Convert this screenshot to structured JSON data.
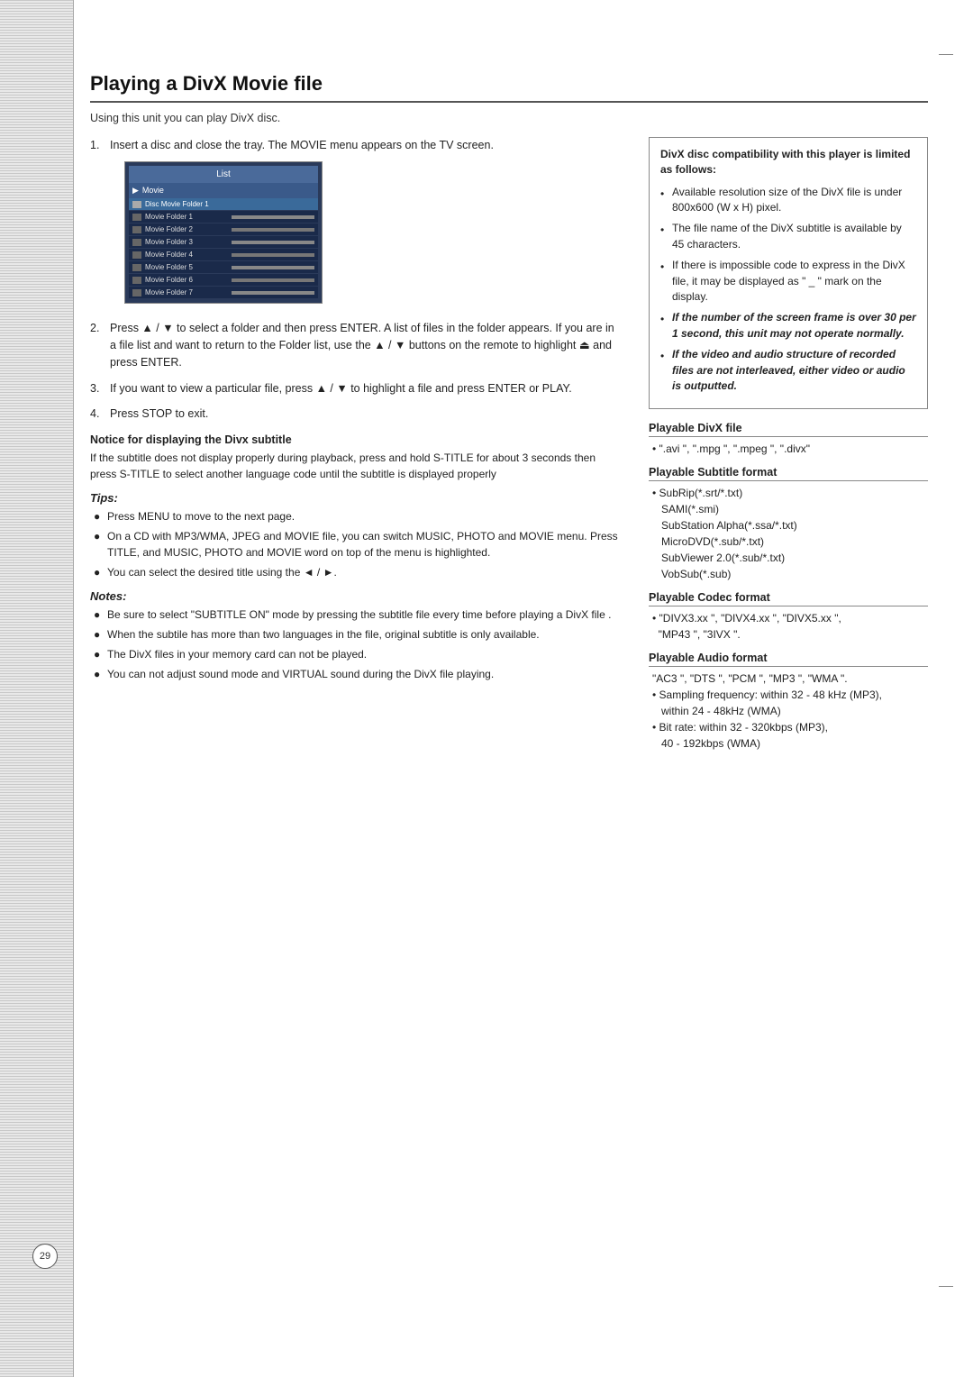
{
  "page": {
    "number": "29",
    "title": "Playing a DivX Movie file",
    "intro": "Using this unit you can play DivX disc."
  },
  "steps": [
    {
      "number": "1.",
      "text": "Insert a disc and close the tray. The MOVIE menu appears on the TV screen."
    },
    {
      "number": "2.",
      "text": "Press ▲ / ▼ to select a folder and then press ENTER. A list of files in the folder appears. If you are in a file list and want to return to the Folder list, use the ▲ / ▼ buttons on the remote to highlight ⏏  and press ENTER."
    },
    {
      "number": "3.",
      "text": "If you want to view a particular file, press ▲ / ▼ to highlight a file and press ENTER or PLAY."
    },
    {
      "number": "4.",
      "text": "Press STOP to exit."
    }
  ],
  "notice": {
    "title": "Notice for displaying the Divx subtitle",
    "text": "If the subtitle does not display properly during playback, press and hold S-TITLE for about 3 seconds then press S-TITLE to select another language code until the subtitle is displayed properly"
  },
  "tips": {
    "title": "Tips:",
    "items": [
      "Press MENU to move to the next page.",
      "On a CD with MP3/WMA, JPEG and MOVIE file, you can switch MUSIC, PHOTO and MOVIE menu. Press TITLE, and MUSIC, PHOTO and MOVIE word on top of the menu is highlighted.",
      "You can select the desired title using the ◄ / ►."
    ]
  },
  "notes": {
    "title": "Notes:",
    "items": [
      "Be sure to select \"SUBTITLE ON\" mode by pressing the subtitle file every time before playing a DivX file .",
      "When the subtile has more than two languages in the file, original subtitle is only available.",
      "The DivX files in your memory card can not be played.",
      "You can not adjust sound mode and VIRTUAL sound during the DivX file playing."
    ]
  },
  "compatibility": {
    "title": "DivX disc compatibility with this player is limited as follows:",
    "bullets": [
      {
        "text": "Available resolution size of the DivX file is under 800x600 (W x H) pixel.",
        "bold": false
      },
      {
        "text": "The file name of the DivX subtitle is available by 45 characters.",
        "bold": false
      },
      {
        "text": "If there is impossible code to express in the DivX file, it may be displayed as \" _ \" mark on the display.",
        "bold": false
      },
      {
        "text": "If the number of the screen frame is over 30 per 1 second, this unit may not operate normally.",
        "bold": true
      },
      {
        "text": "If the video and audio structure of recorded files are not interleaved, either video or audio is outputted.",
        "bold": true
      }
    ]
  },
  "formats": [
    {
      "title": "Playable DivX file",
      "content": "• \".avi \", \".mpg \", \".mpeg \", \".divx\""
    },
    {
      "title": "Playable Subtitle format",
      "lines": [
        "• SubRip(*.srt/*.txt)",
        "  SAMI(*.smi)",
        "  SubStation Alpha(*.ssa/*.txt)",
        "  MicroDVD(*.sub/*.txt)",
        "  SubViewer 2.0(*.sub/*.txt)",
        "  VobSub(*.sub)"
      ]
    },
    {
      "title": "Playable Codec format",
      "content": "• \"DIVX3.xx \", \"DIVX4.xx \", \"DIVX5.xx \",\n  \"MP43 \", \"3IVX \"."
    },
    {
      "title": "Playable Audio format",
      "lines": [
        "\"AC3 \", \"DTS \", \"PCM \", \"MP3 \", \"WMA \".",
        "• Sampling frequency: within 32 - 48 kHz (MP3),",
        "  within 24 - 48kHz (WMA)",
        "• Bit rate: within 32 - 320kbps (MP3),",
        "  40 - 192kbps (WMA)"
      ]
    }
  ],
  "screen": {
    "header": "List",
    "subheader": "▶ Movie",
    "rows": [
      {
        "label": "Disc Movie Folder 1",
        "selected": true
      },
      {
        "label": "Movie Folder 1",
        "selected": false
      },
      {
        "label": "Movie Folder 2",
        "selected": false
      },
      {
        "label": "Movie Folder 3",
        "selected": false
      },
      {
        "label": "Movie Folder 4",
        "selected": false
      },
      {
        "label": "Movie Folder 5",
        "selected": false
      },
      {
        "label": "Movie Folder 6",
        "selected": false
      },
      {
        "label": "Movie Folder 7",
        "selected": false
      }
    ]
  }
}
